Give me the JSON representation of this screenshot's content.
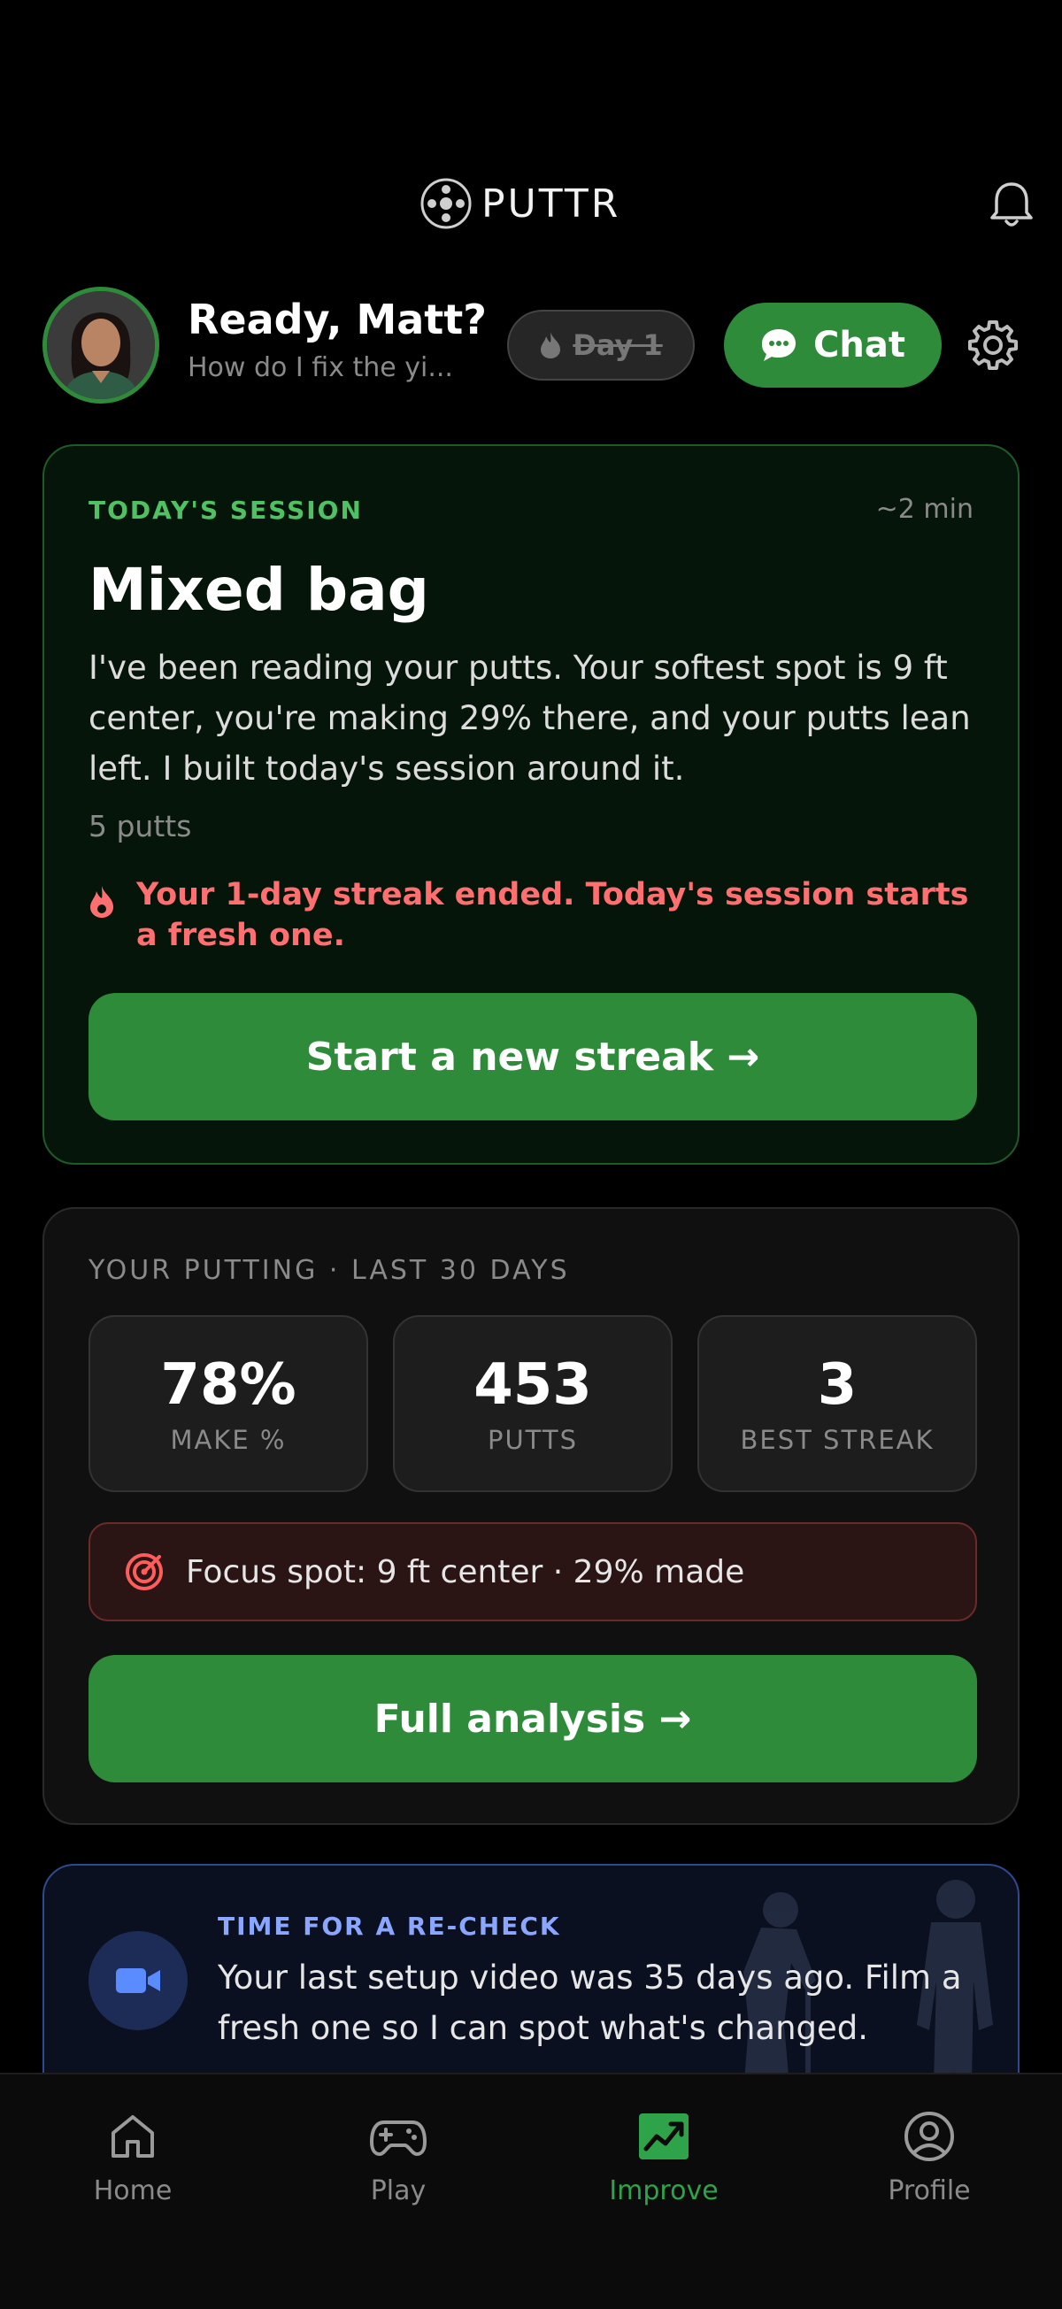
{
  "app": {
    "logo_text": "PUTTR"
  },
  "header": {
    "greeting": "Ready, Matt?",
    "subtitle": "How do I fix the yi...",
    "streak_pill": "Day 1",
    "chat_label": "Chat"
  },
  "session": {
    "eyebrow": "TODAY'S SESSION",
    "duration": "~2 min",
    "title": "Mixed bag",
    "body": "I've been reading your putts. Your softest spot is 9 ft center, you're making 29% there, and your putts lean left. I built today's session around it.",
    "putts": "5 putts",
    "streak_note": "Your 1-day streak ended. Today's session starts a fresh one.",
    "cta": "Start a new streak →"
  },
  "stats": {
    "eyebrow": "YOUR PUTTING · LAST 30 DAYS",
    "tiles": [
      {
        "value": "78%",
        "label": "MAKE %"
      },
      {
        "value": "453",
        "label": "PUTTS"
      },
      {
        "value": "3",
        "label": "BEST STREAK"
      }
    ],
    "focus": "Focus spot: 9 ft center · 29% made",
    "cta": "Full analysis →"
  },
  "recheck": {
    "eyebrow": "TIME FOR A RE-CHECK",
    "body": "Your last setup video was 35 days ago. Film a fresh one so I can spot what's changed."
  },
  "tabs": [
    {
      "label": "Home",
      "icon": "home-icon"
    },
    {
      "label": "Play",
      "icon": "gamepad-icon"
    },
    {
      "label": "Improve",
      "icon": "chart-icon",
      "active": true
    },
    {
      "label": "Profile",
      "icon": "profile-icon"
    }
  ],
  "colors": {
    "accent": "#2e8b3a",
    "accent_text": "#4fc163",
    "alert": "#ff6f6f",
    "info": "#8aa6ff"
  }
}
